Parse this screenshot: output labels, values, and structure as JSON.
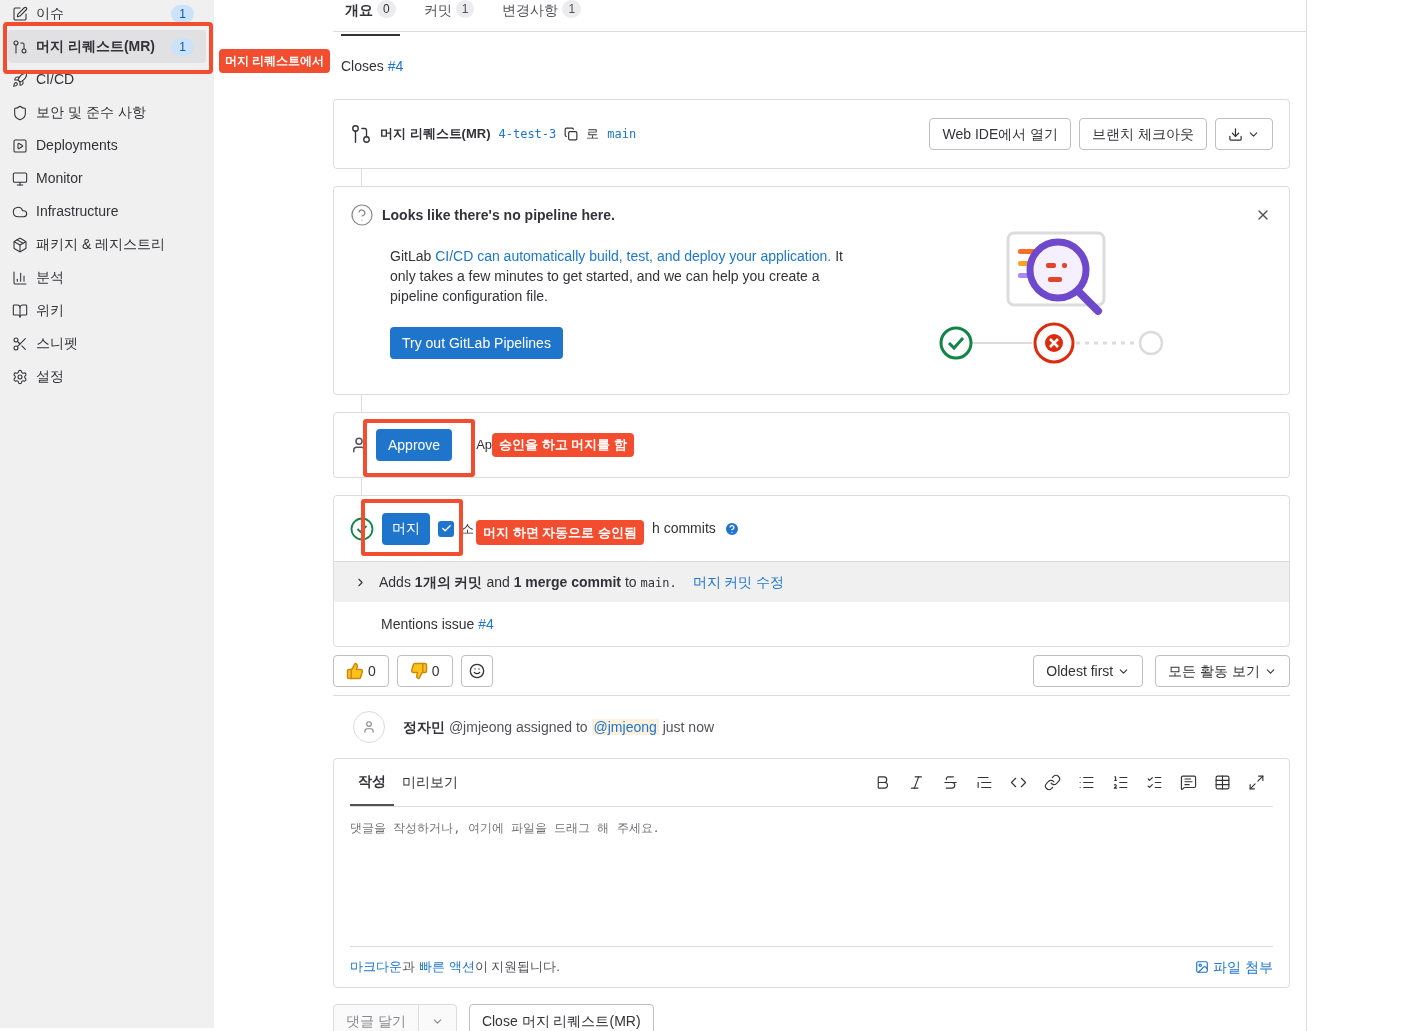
{
  "sidebar": {
    "items": [
      {
        "label": "이슈",
        "badge": "1",
        "selected": false
      },
      {
        "label": "머지 리퀘스트(MR)",
        "badge": "1",
        "selected": true
      },
      {
        "label": "CI/CD",
        "selected": false
      },
      {
        "label": "보안 및 준수 사항",
        "selected": false
      },
      {
        "label": "Deployments",
        "selected": false
      },
      {
        "label": "Monitor",
        "selected": false
      },
      {
        "label": "Infrastructure",
        "selected": false
      },
      {
        "label": "패키지 & 레지스트리",
        "selected": false
      },
      {
        "label": "분석",
        "selected": false
      },
      {
        "label": "위키",
        "selected": false
      },
      {
        "label": "스니펫",
        "selected": false
      },
      {
        "label": "설정",
        "selected": false
      }
    ]
  },
  "tabs": [
    {
      "label": "개요",
      "count": "0",
      "selected": true
    },
    {
      "label": "커밋",
      "count": "1",
      "selected": false
    },
    {
      "label": "변경사항",
      "count": "1",
      "selected": false
    }
  ],
  "description": {
    "text": "Closes",
    "link": "#4"
  },
  "mr_header": {
    "title": "머지 리퀘스트(MR)",
    "source_branch": "4-test-3",
    "connector": "로",
    "target_branch": "main",
    "buttons": [
      "Web IDE에서 열기",
      "브랜치 체크아웃"
    ]
  },
  "pipeline": {
    "title": "Looks like there's no pipeline here.",
    "body_before": "GitLab",
    "link": "CI/CD can automatically build, test, and deploy your application.",
    "body_after": "It only takes a few minutes to get started, and we can help you create a pipeline configuration file.",
    "button": "Try out GitLab Pipelines"
  },
  "approval": {
    "button": "Approve",
    "text": "Ap"
  },
  "merge": {
    "button": "머지",
    "squash_checked": true,
    "text_before": "소",
    "text_after": "h commits",
    "summary": "Adds **1개의 커밋** and **1 merge commit** to",
    "summary_branch": "main.",
    "edit_link": "머지 커밋 수정",
    "mentions": "Mentions issue",
    "mentions_link": "#4"
  },
  "reactions": [
    {
      "kind": "thumbs_up",
      "count": "0"
    },
    {
      "kind": "thumbs_down",
      "count": "0"
    }
  ],
  "sort": [
    "Oldest first",
    "모든 활동 보기"
  ],
  "activity": {
    "author": "정자민",
    "handle": "@jmjeong assigned to",
    "mention": "@jmjeong",
    "time": "just now"
  },
  "editor": {
    "tabs": [
      {
        "label": "작성",
        "selected": true
      },
      {
        "label": "미리보기",
        "selected": false
      }
    ],
    "placeholder": "댓글을 작성하거나, 여기에 파일을 드래그 해 주세요.",
    "footer": [
      {
        "text": "마크다운",
        "link": true
      },
      {
        "text": "과",
        "link": false
      },
      {
        "text": "빠른 액션",
        "link": true
      },
      {
        "text": "이 지원됩니다.",
        "link": false
      }
    ],
    "attach": "파일 첨부"
  },
  "actions": [
    "댓글 달기",
    "Close 머지 리퀘스트(MR)"
  ],
  "annotations": [
    "머지 리퀘스트에서",
    "승인을 하고 머지를 함",
    "머지 하면 자동으로 승인됨"
  ]
}
